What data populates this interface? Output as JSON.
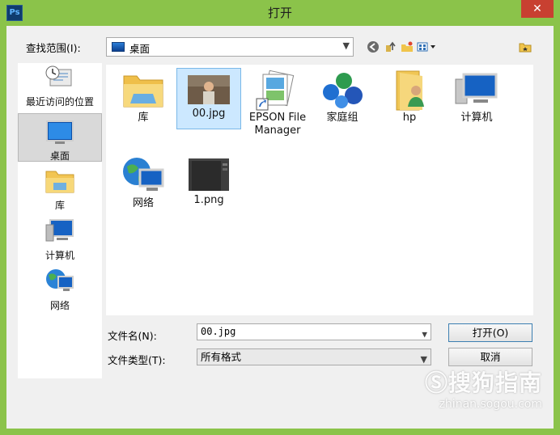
{
  "window": {
    "title": "打开",
    "app_icon": "Ps",
    "close_glyph": "✕",
    "accent": "#8bc34a"
  },
  "toolbar": {
    "look_in_label": "查找范围(I):",
    "look_in_value": "桌面",
    "icons": [
      "back-icon",
      "up-folder-icon",
      "new-folder-icon",
      "view-menu-icon"
    ]
  },
  "sidebar": {
    "items": [
      {
        "label": "最近访问的位置",
        "icon": "recent-places-icon"
      },
      {
        "label": "桌面",
        "icon": "desktop-icon",
        "selected": true
      },
      {
        "label": "库",
        "icon": "library-icon"
      },
      {
        "label": "计算机",
        "icon": "computer-icon"
      },
      {
        "label": "网络",
        "icon": "network-icon"
      }
    ]
  },
  "files": {
    "items": [
      {
        "label": "库",
        "icon": "library-folder-icon"
      },
      {
        "label": "00.jpg",
        "icon": "photo-thumbnail-icon",
        "selected": true
      },
      {
        "label_line1": "EPSON File",
        "label_line2": "Manager",
        "icon": "epson-shortcut-icon"
      },
      {
        "label": "家庭组",
        "icon": "homegroup-icon"
      },
      {
        "label": "hp",
        "icon": "user-folder-icon"
      },
      {
        "label": "计算机",
        "icon": "computer-icon"
      },
      {
        "label": "网络",
        "icon": "network-icon"
      },
      {
        "label": "1.png",
        "icon": "png-thumbnail-icon"
      }
    ]
  },
  "form": {
    "file_name_label": "文件名(N):",
    "file_name_value": "00.jpg",
    "file_type_label": "文件类型(T):",
    "file_type_value": "所有格式",
    "open_button": "打开(O)",
    "cancel_button": "取消"
  },
  "watermark": {
    "logo_text": "Ⓢ搜狗指南",
    "url": "zhinan.sogou.com"
  }
}
